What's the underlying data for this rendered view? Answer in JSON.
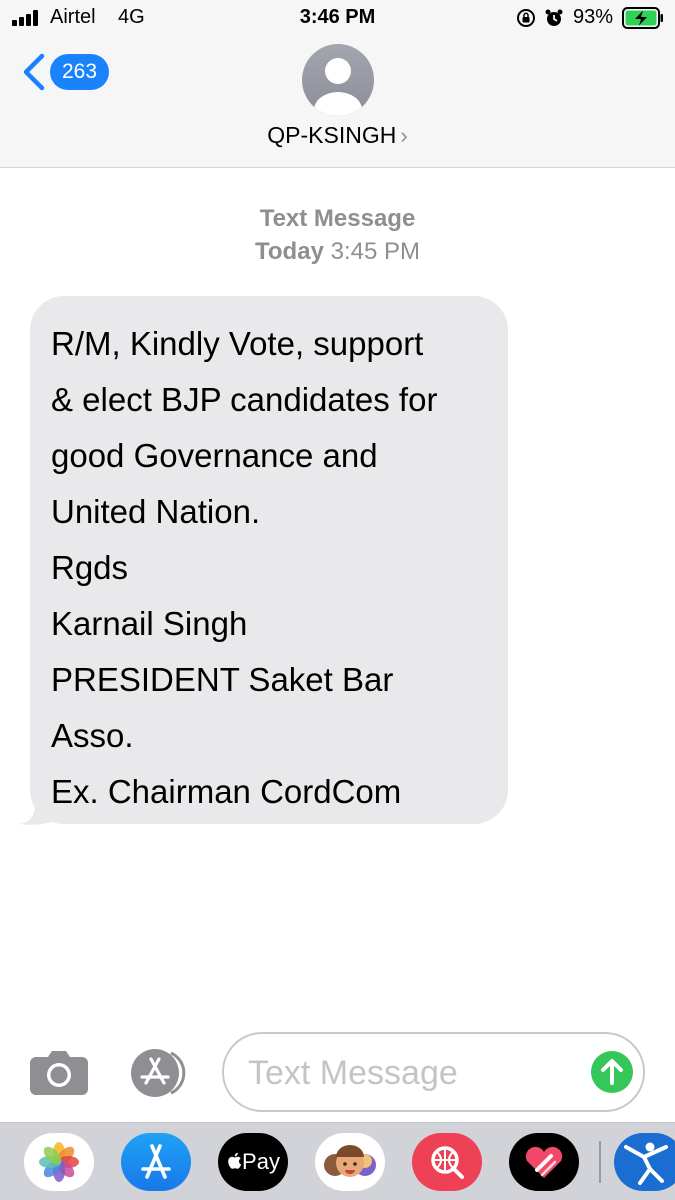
{
  "status_bar": {
    "carrier": "Airtel",
    "network": "4G",
    "time": "3:46 PM",
    "battery_percent": "93%",
    "icons": [
      "signal-bars-icon",
      "orientation-lock-icon",
      "alarm-icon",
      "battery-charging-icon"
    ]
  },
  "header": {
    "back_badge_count": "263",
    "contact_name": "QP-KSINGH",
    "contact_chevron": "›"
  },
  "conversation": {
    "meta_type": "Text Message",
    "meta_day": "Today",
    "meta_time": "3:45 PM",
    "message_lines": [
      "R/M, Kindly Vote, support",
      "& elect BJP candidates for",
      "good Governance and",
      "United Nation.",
      "Rgds",
      "Karnail Singh",
      "PRESIDENT Saket Bar",
      "Asso.",
      "Ex. Chairman CordCom"
    ]
  },
  "input_bar": {
    "placeholder": "Text Message"
  },
  "app_drawer": {
    "items": [
      "photos-app-icon",
      "app-store-app-icon",
      "apple-pay-app-icon",
      "memoji-app-icon",
      "web-search-app-icon",
      "digital-touch-app-icon",
      "fitness-app-icon"
    ],
    "apple_pay_label": "Pay"
  },
  "colors": {
    "ios_blue": "#1a82fb",
    "send_green": "#35c759",
    "bubble_gray": "#e9e9eb",
    "meta_gray": "#8e8e93",
    "battery_green": "#30d158"
  }
}
